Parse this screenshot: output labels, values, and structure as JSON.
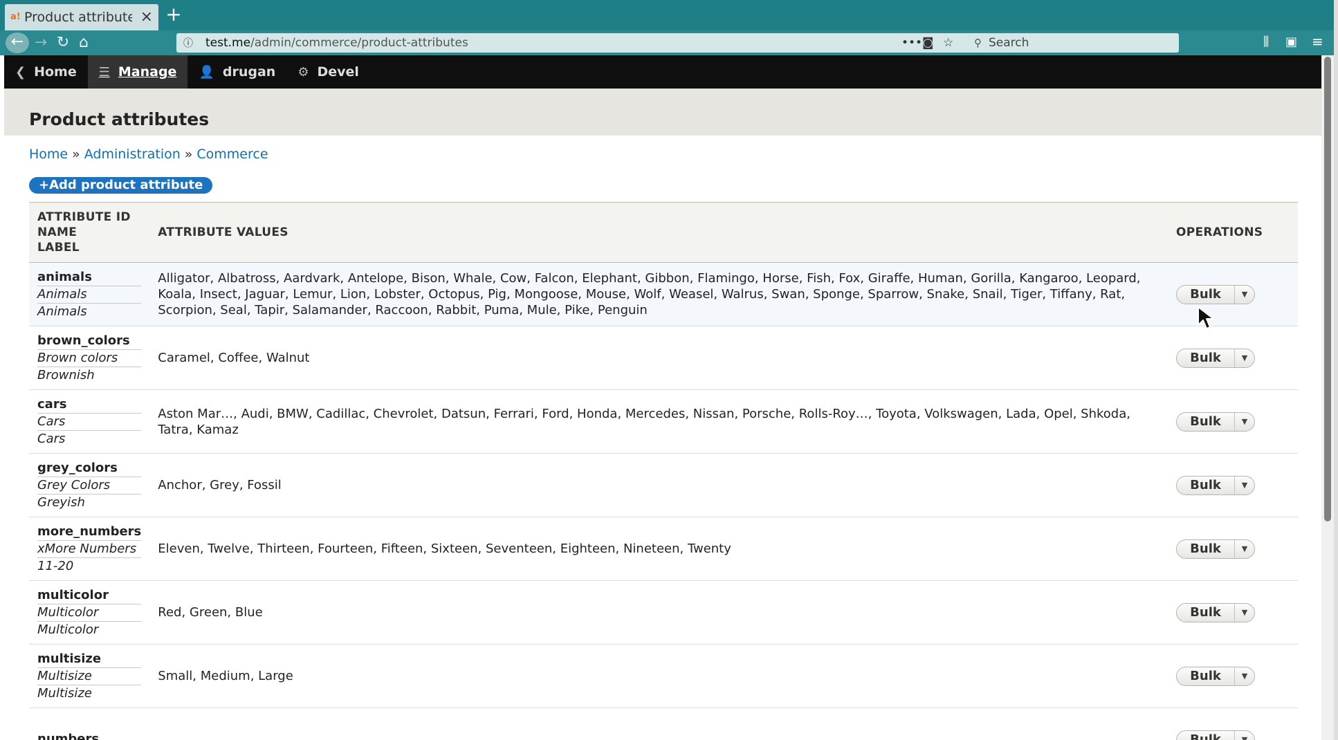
{
  "browser": {
    "tab_title": "Product attributes",
    "tab_favicon": "a!",
    "new_tab": "+",
    "url_host": "test.me",
    "url_path": "/admin/commerce/product-attributes",
    "search_placeholder": "Search"
  },
  "toolbar": {
    "home": "Home",
    "manage": "Manage",
    "user": "drugan",
    "devel": "Devel"
  },
  "page": {
    "title": "Product attributes",
    "breadcrumb": [
      "Home",
      "Administration",
      "Commerce"
    ],
    "add_button": "+Add product attribute"
  },
  "table": {
    "header_id": [
      "ATTRIBUTE ID",
      "NAME",
      "LABEL"
    ],
    "header_values": "ATTRIBUTE VALUES",
    "header_ops": "OPERATIONS",
    "op_label": "Bulk",
    "rows": [
      {
        "id": "animals",
        "name": "Animals",
        "label": "Animals",
        "values": "Alligator, Albatross, Aardvark, Antelope, Bison, Whale, Cow, Falcon, Elephant, Gibbon, Flamingo, Horse, Fish, Fox, Giraffe, Human, Gorilla, Kangaroo, Leopard, Koala, Insect, Jaguar, Lemur, Lion, Lobster, Octopus, Pig, Mongoose, Mouse, Wolf, Weasel, Walrus, Swan, Sponge, Sparrow, Snake, Snail, Tiger, Tiffany, Rat, Scorpion, Seal, Tapir, Salamander, Raccoon, Rabbit, Puma, Mule, Pike, Penguin"
      },
      {
        "id": "brown_colors",
        "name": "Brown colors",
        "label": "Brownish",
        "values": "Caramel, Coffee, Walnut"
      },
      {
        "id": "cars",
        "name": "Cars",
        "label": "Cars",
        "values": "Aston Mar…, Audi, BMW, Cadillac, Chevrolet, Datsun, Ferrari, Ford, Honda, Mercedes, Nissan, Porsche, Rolls-Roy…, Toyota, Volkswagen, Lada, Opel, Shkoda, Tatra, Kamaz"
      },
      {
        "id": "grey_colors",
        "name": "Grey Colors",
        "label": "Greyish",
        "values": "Anchor, Grey, Fossil"
      },
      {
        "id": "more_numbers",
        "name": "xMore Numbers",
        "label": "11-20",
        "values": "Eleven, Twelve, Thirteen, Fourteen, Fifteen, Sixteen, Seventeen, Eighteen, Nineteen, Twenty"
      },
      {
        "id": "multicolor",
        "name": "Multicolor",
        "label": "Multicolor",
        "values": "Red, Green, Blue"
      },
      {
        "id": "multisize",
        "name": "Multisize",
        "label": "Multisize",
        "values": "Small, Medium, Large"
      },
      {
        "id": "numbers",
        "name": "",
        "label": "",
        "values": ""
      }
    ]
  },
  "colors": {
    "browser_tabbar": "#1f7f86",
    "toolbar_bg": "#0f0f0f",
    "link": "#0a70b8",
    "primary_button": "#1c73c2"
  },
  "icons": {
    "back": "arrow-left-icon",
    "forward": "arrow-right-icon",
    "reload": "reload-icon",
    "home": "home-icon",
    "manage": "hamburger-icon",
    "user": "user-icon",
    "devel": "gear-icon"
  }
}
